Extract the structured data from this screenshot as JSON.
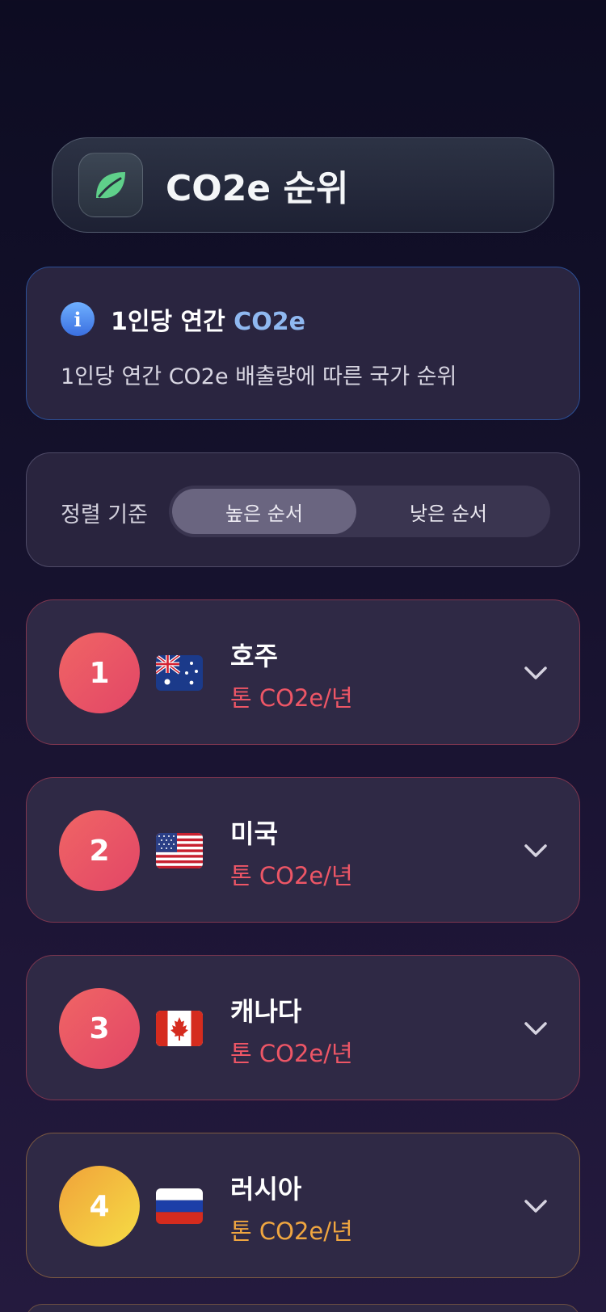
{
  "header": {
    "title": "CO2e 순위",
    "logo_icon": "leaf-icon"
  },
  "info": {
    "title_main": "1인당 연간",
    "title_accent": "CO2e",
    "description": "1인당 연간 CO2e 배출량에 따른 국가 순위",
    "icon": "info-icon"
  },
  "sort": {
    "label": "정렬 기준",
    "options": [
      "높은 순서",
      "낮은 순서"
    ],
    "selected": "높은 순서"
  },
  "rankings": [
    {
      "rank": "1",
      "country": "호주",
      "unit": "톤 CO2e/년",
      "flag": "australia-flag-icon"
    },
    {
      "rank": "2",
      "country": "미국",
      "unit": "톤 CO2e/년",
      "flag": "usa-flag-icon"
    },
    {
      "rank": "3",
      "country": "캐나다",
      "unit": "톤 CO2e/년",
      "flag": "canada-flag-icon"
    },
    {
      "rank": "4",
      "country": "러시아",
      "unit": "톤 CO2e/년",
      "flag": "russia-flag-icon"
    }
  ],
  "colors": {
    "accent_blue": "#8fb8f0",
    "rank_red": "#ee5666",
    "rank_orange": "#f0a640",
    "leaf_green": "#5fd08a"
  }
}
